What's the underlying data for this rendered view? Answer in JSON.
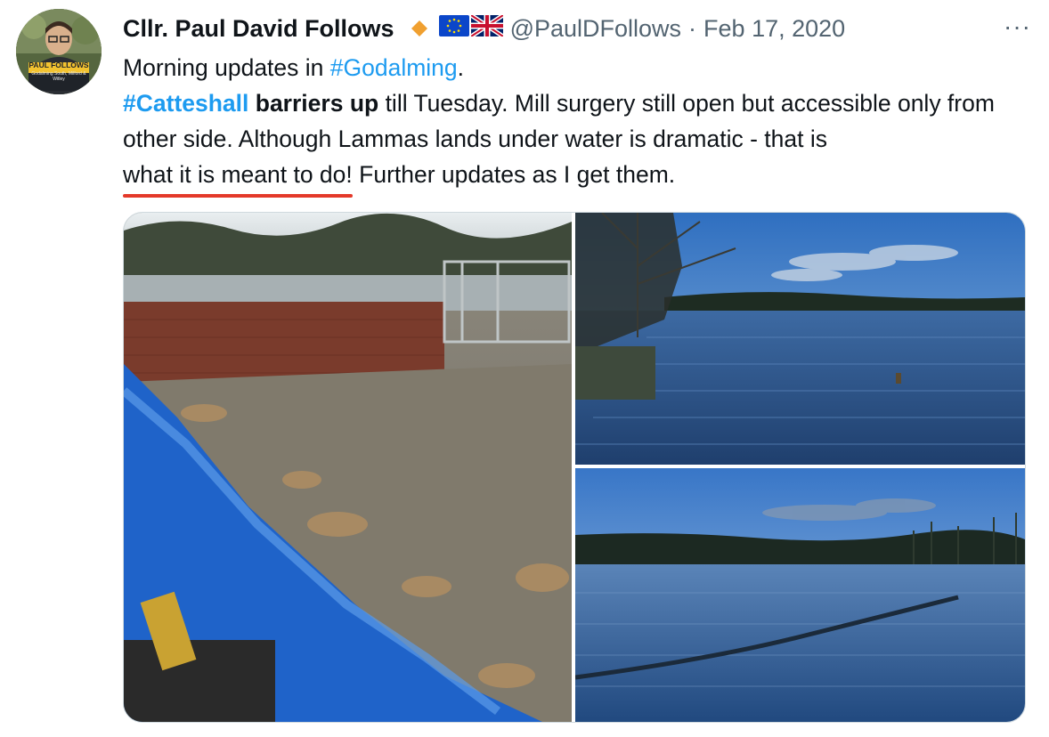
{
  "author": {
    "name": "Cllr. Paul David Follows",
    "handle": "@PaulDFollows",
    "separator": "·",
    "date": "Feb 17, 2020",
    "avatar_label": "PAUL FOLLOWS",
    "avatar_sublabel": "Godalming South, Milford & Witley",
    "badge_icon": "orange-diamond-icon",
    "flag_icons": [
      "eu-flag-icon",
      "uk-flag-icon"
    ]
  },
  "more_label": "···",
  "text": {
    "line1_prefix": "Morning updates in ",
    "line1_hashtag": "#Godalming",
    "line1_suffix": ".",
    "line2_hashtag": "#Catteshall",
    "line2_bold": " barriers up",
    "line2_rest": " till Tuesday. Mill surgery still open but accessible only from other side. Although Lammas lands under water is dramatic - that is ",
    "underlined": "what it is meant to do!",
    "line_end": " Further updates as I get them."
  },
  "colors": {
    "hashtag": "#1d9bf0",
    "underline": "#e4392a",
    "muted": "#536471",
    "diamond": "#f0a030"
  },
  "media": [
    {
      "name": "flood-barrier-photo"
    },
    {
      "name": "flooded-field-tree-photo"
    },
    {
      "name": "flooded-meadow-photo"
    }
  ]
}
